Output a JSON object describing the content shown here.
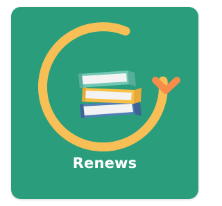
{
  "tile": {
    "label": "Renews",
    "icon": "renew-books-icon"
  },
  "colors": {
    "tile_background": "#2a9d7c",
    "arrow": "#f7bf55",
    "arrow_head": "#f58c4a",
    "label_text": "#ffffff",
    "book_top": "#6fc7b4",
    "book_middle": "#f7c046",
    "book_bottom": "#4f7fb5",
    "pages": "#f3f3f3"
  }
}
